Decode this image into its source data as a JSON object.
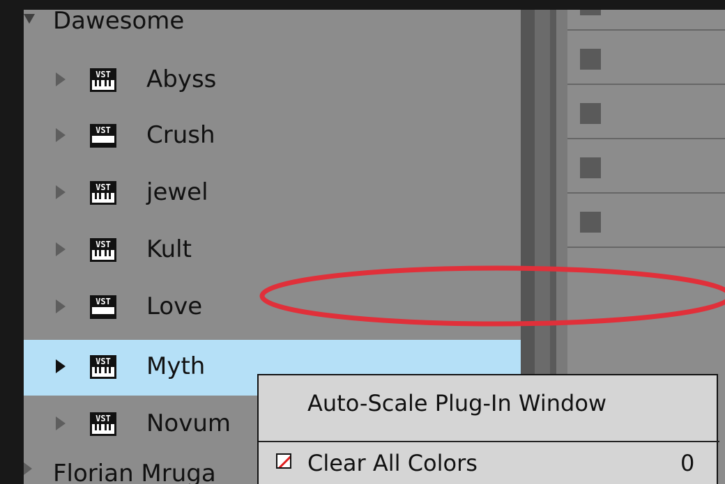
{
  "browser": {
    "folder": "Dawesome",
    "plugins": [
      {
        "label": "Abyss",
        "icon": "vst-instrument-icon",
        "selected": false
      },
      {
        "label": "Crush",
        "icon": "vst-effect-icon",
        "selected": false
      },
      {
        "label": "jewel",
        "icon": "vst-instrument-icon",
        "selected": false
      },
      {
        "label": "Kult",
        "icon": "vst-instrument-icon",
        "selected": false
      },
      {
        "label": "Love",
        "icon": "vst-effect-icon",
        "selected": false
      },
      {
        "label": "Myth",
        "icon": "vst-instrument-icon",
        "selected": true
      },
      {
        "label": "Novum",
        "icon": "vst-instrument-icon",
        "selected": false
      }
    ],
    "next_folder": "Florian Mruga"
  },
  "context_menu": {
    "item1": "Auto-Scale Plug-In Window",
    "item2": "Clear All Colors",
    "item2_shortcut": "0"
  },
  "colors": {
    "panel": "#8c8c8c",
    "selection": "#b5e0f7",
    "annotation": "#e0303a",
    "menu_bg": "#d5d5d5"
  }
}
